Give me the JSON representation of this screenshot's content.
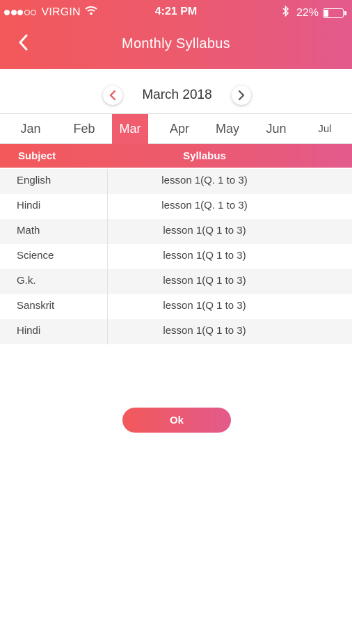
{
  "status_bar": {
    "carrier": "VIRGIN",
    "time": "4:21 PM",
    "battery": "22%",
    "battery_level": 0.22,
    "icons": [
      "signal-dots",
      "wifi-icon",
      "bluetooth-icon",
      "battery-icon"
    ]
  },
  "header": {
    "title": "Monthly Syllabus",
    "back_icon": "chevron-left-icon"
  },
  "month_nav": {
    "current": "March 2018",
    "prev_icon": "chevron-left-icon",
    "next_icon": "chevron-right-icon"
  },
  "months": [
    "Jan",
    "Feb",
    "Mar",
    "Apr",
    "May",
    "Jun",
    "Jul"
  ],
  "selected_month": "Mar",
  "table": {
    "columns": [
      "Subject",
      "Syllabus"
    ],
    "rows": [
      {
        "subject": "English",
        "syllabus": "lesson 1(Q. 1 to 3)"
      },
      {
        "subject": "Hindi",
        "syllabus": "lesson 1(Q. 1 to 3)"
      },
      {
        "subject": "Math",
        "syllabus": "lesson 1(Q 1 to 3)"
      },
      {
        "subject": "Science",
        "syllabus": "lesson 1(Q 1 to 3)"
      },
      {
        "subject": "G.k.",
        "syllabus": "lesson 1(Q 1 to 3)"
      },
      {
        "subject": "Sanskrit",
        "syllabus": "lesson 1(Q 1 to 3)"
      },
      {
        "subject": "Hindi",
        "syllabus": "lesson 1(Q 1 to 3)"
      }
    ]
  },
  "ok_label": "Ok",
  "colors": {
    "accent_start": "#f2595a",
    "accent_end": "#e35a8c",
    "selected_tab": "#ef5d6f"
  }
}
